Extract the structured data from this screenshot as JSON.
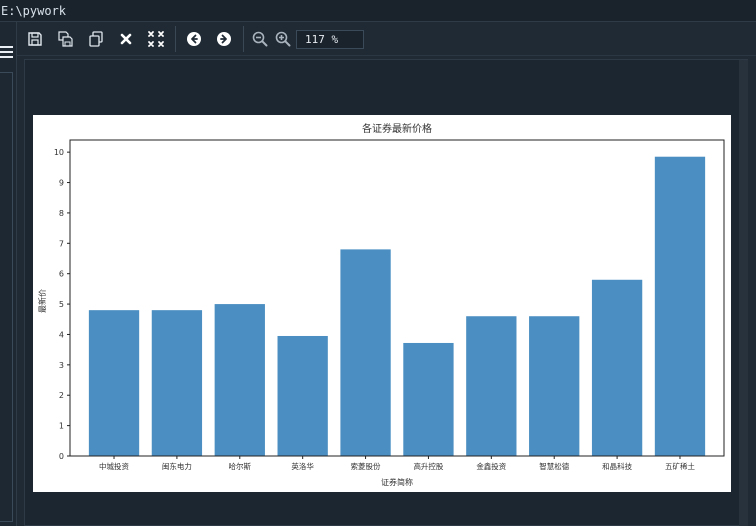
{
  "window": {
    "path": "E:\\pywork"
  },
  "toolbar": {
    "zoom_value": "117 %",
    "buttons": [
      {
        "name": "save-button",
        "icon": "save-icon"
      },
      {
        "name": "save-all-button",
        "icon": "save-all-icon"
      },
      {
        "name": "copy-button",
        "icon": "copy-icon"
      },
      {
        "name": "close-button",
        "icon": "close-icon"
      },
      {
        "name": "close-all-button",
        "icon": "close-all-icon"
      },
      {
        "name": "previous-button",
        "icon": "arrow-left-icon"
      },
      {
        "name": "next-button",
        "icon": "arrow-right-icon"
      },
      {
        "name": "zoom-out-button",
        "icon": "zoom-out-icon"
      },
      {
        "name": "zoom-in-button",
        "icon": "zoom-in-icon"
      }
    ]
  },
  "sidebar": {
    "menu_icon": "hamburger-menu-icon"
  },
  "colors": {
    "bar": "#4b8fc2",
    "background": "#1f2a35"
  },
  "chart_data": {
    "type": "bar",
    "title": "各证券最新价格",
    "xlabel": "证券简称",
    "ylabel": "最新价",
    "categories": [
      "中城投资",
      "闽东电力",
      "哈尔斯",
      "英洛华",
      "索菱股份",
      "高升控股",
      "金鑫投资",
      "智慧松德",
      "和晶科技",
      "五矿稀土"
    ],
    "values": [
      4.8,
      4.8,
      5.0,
      3.95,
      6.8,
      3.72,
      4.6,
      4.6,
      5.8,
      9.85
    ],
    "ylim": [
      0,
      10.4
    ],
    "yticks": [
      0,
      1,
      2,
      3,
      4,
      5,
      6,
      7,
      8,
      9,
      10
    ],
    "grid": false
  }
}
